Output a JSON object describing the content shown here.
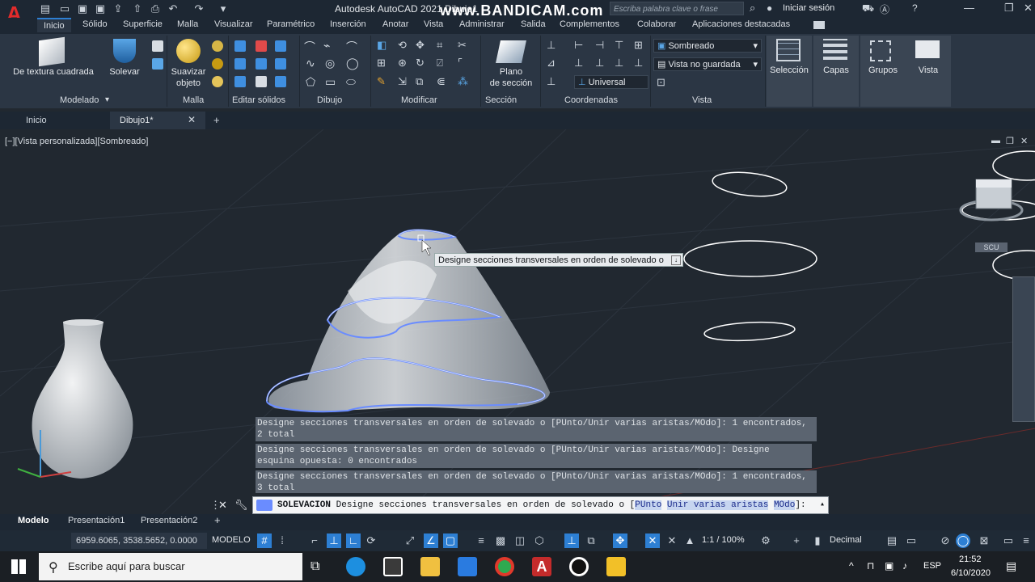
{
  "app": {
    "title": "Autodesk AutoCAD 2021  Dibujo1",
    "watermark": "www.BANDICAM.com",
    "search_placeholder": "Escriba palabra clave o frase",
    "signin": "Iniciar sesión"
  },
  "ribbon_tabs": [
    "Inicio",
    "Sólido",
    "Superficie",
    "Malla",
    "Visualizar",
    "Paramétrico",
    "Inserción",
    "Anotar",
    "Vista",
    "Administrar",
    "Salida",
    "Complementos",
    "Colaborar",
    "Aplicaciones destacadas"
  ],
  "ribbon": {
    "buttons": {
      "texture": "De textura cuadrada",
      "solevar": "Solevar",
      "suavizar_line1": "Suavizar",
      "suavizar_line2": "objeto",
      "plano_line1": "Plano",
      "plano_line2": "de sección",
      "seleccion": "Selección",
      "capas": "Capas",
      "grupos": "Grupos",
      "vista": "Vista"
    },
    "combos": {
      "visual_style": "Sombreado",
      "named_view": "Vista no guardada",
      "ucs": "Universal"
    },
    "panels": [
      "Modelado",
      "Malla",
      "Editar sólidos",
      "Dibujo",
      "Modificar",
      "Sección",
      "Coordenadas",
      "Vista"
    ]
  },
  "file_tabs": {
    "start": "Inicio",
    "drawing": "Dibujo1*"
  },
  "viewport": {
    "label": "[−][Vista personalizada][Sombreado]",
    "tooltip": "Designe secciones transversales en orden de solevado o",
    "viewcube_label": "SCU"
  },
  "command_history": [
    "Designe secciones transversales en orden de solevado o [PUnto/Unir varias aristas/MOdo]: 1 encontrados, 2 total",
    "Designe secciones transversales en orden de solevado o [PUnto/Unir varias aristas/MOdo]: Designe esquina opuesta: 0 encontrados",
    "Designe secciones transversales en orden de solevado o [PUnto/Unir varias aristas/MOdo]: 1 encontrados, 3 total"
  ],
  "command_line": {
    "command": "SOLEVACION",
    "prompt": "Designe secciones transversales en orden de solevado o [",
    "opt1": "PUnto",
    "opt2": "Unir varias aristas",
    "opt3": "MOdo",
    "suffix": "]:"
  },
  "layout_tabs": [
    "Modelo",
    "Presentación1",
    "Presentación2"
  ],
  "status": {
    "coords": "6959.6065, 3538.5652, 0.0000",
    "mode": "MODELO",
    "scale": "1:1 / 100%",
    "units": "Decimal"
  },
  "taskbar": {
    "search": "Escribe aquí para buscar",
    "lang": "ESP",
    "time": "21:52",
    "date": "6/10/2020"
  },
  "colors": {
    "accent": "#2d7fd3",
    "background": "#212830",
    "ribbon": "#2b3644",
    "selection": "#6a8cff"
  }
}
